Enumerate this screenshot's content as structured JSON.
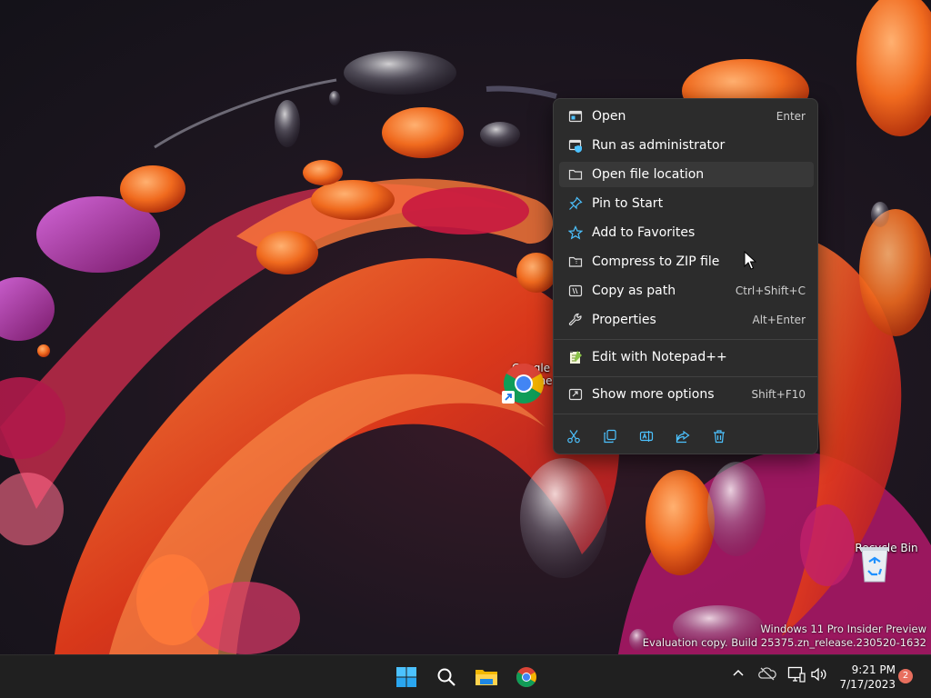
{
  "desktop": {
    "icons": [
      {
        "label_line1": "Google",
        "label_line2": "Chrome"
      },
      {
        "label": "Recycle Bin"
      }
    ],
    "watermark": {
      "line1": "Windows 11 Pro Insider Preview",
      "line2": "Evaluation copy. Build 25375.zn_release.230520-1632"
    }
  },
  "context_menu": {
    "items": [
      {
        "label": "Open",
        "shortcut": "Enter",
        "icon": "open-icon"
      },
      {
        "label": "Run as administrator",
        "shortcut": "",
        "icon": "admin-shield-icon"
      },
      {
        "label": "Open file location",
        "shortcut": "",
        "icon": "folder-icon",
        "highlighted": true
      },
      {
        "label": "Pin to Start",
        "shortcut": "",
        "icon": "pin-icon"
      },
      {
        "label": "Add to Favorites",
        "shortcut": "",
        "icon": "star-icon"
      },
      {
        "label": "Compress to ZIP file",
        "shortcut": "",
        "icon": "zip-folder-icon"
      },
      {
        "label": "Copy as path",
        "shortcut": "Ctrl+Shift+C",
        "icon": "copy-path-icon"
      },
      {
        "label": "Properties",
        "shortcut": "Alt+Enter",
        "icon": "wrench-icon"
      },
      {
        "label": "Edit with Notepad++",
        "shortcut": "",
        "icon": "notepad-plus-plus-icon"
      },
      {
        "label": "Show more options",
        "shortcut": "Shift+F10",
        "icon": "more-options-icon"
      }
    ],
    "quick_actions": [
      "cut-icon",
      "copy-icon",
      "rename-icon",
      "share-icon",
      "delete-icon"
    ]
  },
  "taskbar": {
    "apps": [
      "start-icon",
      "search-icon",
      "file-explorer-icon",
      "chrome-icon"
    ],
    "tray": [
      "chevron-up-icon",
      "onedrive-icon",
      "network-icon",
      "volume-icon"
    ],
    "clock": {
      "time": "9:21 PM",
      "date": "7/17/2023"
    },
    "notification_count": "2"
  },
  "colors": {
    "menu_bg": "#2c2c2c",
    "highlight": "#383838",
    "accent_blue": "#4cc2ff",
    "taskbar_bg": "#202020",
    "badge": "#e86f5e"
  }
}
